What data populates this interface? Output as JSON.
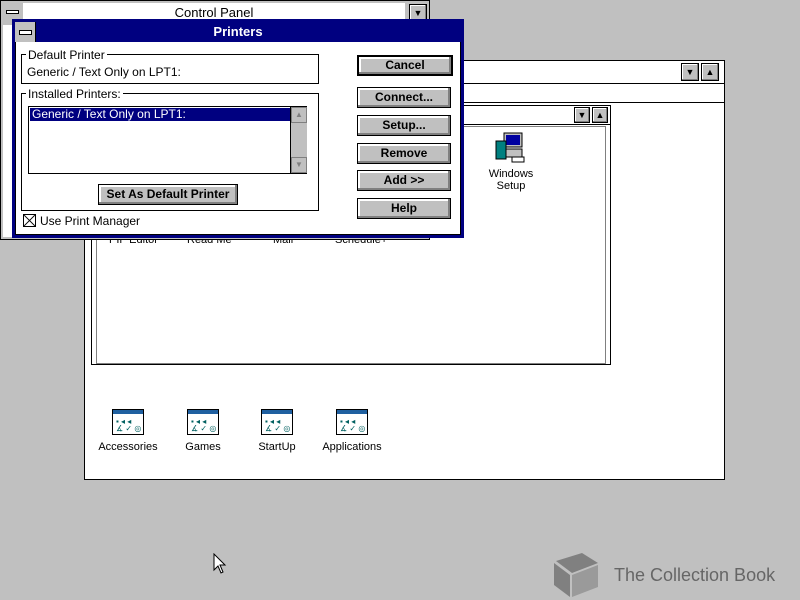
{
  "control_panel": {
    "title": "Control Panel"
  },
  "program_manager": {
    "inner_partial_labels": [
      "PIF Editor",
      "Read Me",
      "Mail",
      "Schedule+"
    ],
    "windows_setup": {
      "label_line1": "Windows",
      "label_line2": "Setup"
    },
    "groups": [
      {
        "label": "Accessories"
      },
      {
        "label": "Games"
      },
      {
        "label": "StartUp"
      },
      {
        "label": "Applications"
      }
    ]
  },
  "printers_dialog": {
    "title": "Printers",
    "default_printer": {
      "label": "Default Printer",
      "value": "Generic / Text Only on LPT1:"
    },
    "installed_printers": {
      "label": "Installed Printers:",
      "items": [
        "Generic / Text Only on LPT1:"
      ],
      "selected_index": 0
    },
    "set_default_button": "Set As Default Printer",
    "use_print_manager": {
      "label": "Use Print Manager",
      "checked": true
    },
    "buttons": {
      "cancel": "Cancel",
      "connect": "Connect...",
      "setup": "Setup...",
      "remove": "Remove",
      "add": "Add >>",
      "help": "Help"
    }
  },
  "watermark": {
    "text": "The Collection Book",
    "icon": "book-icon"
  },
  "colors": {
    "desktop": "#c0c0c0",
    "title_active": "#000080",
    "selection": "#000080"
  }
}
